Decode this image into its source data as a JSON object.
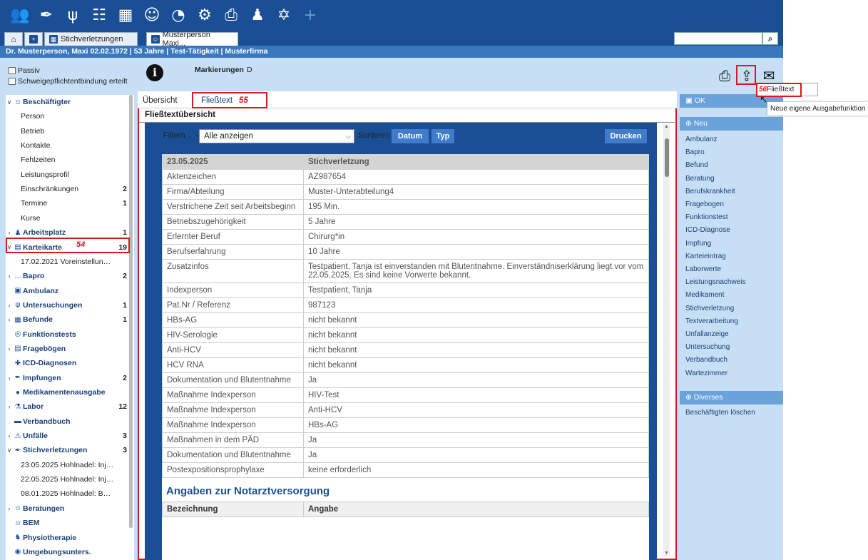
{
  "toolbar": {
    "icons": [
      "group-icon",
      "syringe-icon",
      "stethoscope-icon",
      "org-chart-icon",
      "calendar-icon",
      "person-tie-icon",
      "pie-chart-icon",
      "gear-icon",
      "printer-icon",
      "worker-icon",
      "needle-alert-icon",
      "plus-icon"
    ]
  },
  "tabs": [
    {
      "label": ""
    },
    {
      "label": ""
    },
    {
      "label": "Stichverletzungen"
    },
    {
      "label": "Musterperson Maxi..."
    }
  ],
  "search": {
    "placeholder": ""
  },
  "person_bar": "Dr. Musterperson, Maxi 02.02.1972 | 53 Jahre | Test-Tätigkeit | Musterfirma",
  "header": {
    "passiv": "Passiv",
    "schweige": "Schweigepflichtentbindung erteilt",
    "mark_label": "Markierungen",
    "mark_value": "D"
  },
  "annotations": {
    "a54": "54",
    "a55": "55",
    "a56": "56"
  },
  "sidebar": [
    {
      "label": "Beschäftigter",
      "bold": true,
      "arrow": "v",
      "icon": "person",
      "count": ""
    },
    {
      "label": "Person",
      "sub": true,
      "count": ""
    },
    {
      "label": "Betrieb",
      "sub": true,
      "count": ""
    },
    {
      "label": "Kontakte",
      "sub": true,
      "count": ""
    },
    {
      "label": "Fehlzeiten",
      "sub": true,
      "count": ""
    },
    {
      "label": "Leistungsprofil",
      "sub": true,
      "count": ""
    },
    {
      "label": "Einschränkungen",
      "sub": true,
      "count": "2"
    },
    {
      "label": "Termine",
      "sub": true,
      "count": "1"
    },
    {
      "label": "Kurse",
      "sub": true,
      "count": ""
    },
    {
      "label": "Arbeitsplatz",
      "bold": true,
      "arrow": ">",
      "icon": "worker",
      "count": "1"
    },
    {
      "label": "Karteikarte",
      "bold": true,
      "arrow": "v",
      "icon": "card",
      "count": "19"
    },
    {
      "label": "17.02.2021 Voreinstellunge...",
      "sub": true,
      "count": ""
    },
    {
      "label": "Bapro",
      "bold": true,
      "arrow": ">",
      "icon": "dots",
      "count": "2"
    },
    {
      "label": "Ambulanz",
      "bold": true,
      "arrow": "",
      "icon": "ambulance",
      "count": ""
    },
    {
      "label": "Untersuchungen",
      "bold": true,
      "arrow": ">",
      "icon": "stetho",
      "count": "1"
    },
    {
      "label": "Befunde",
      "bold": true,
      "arrow": ">",
      "icon": "findings",
      "count": "1"
    },
    {
      "label": "Funktionstests",
      "bold": true,
      "arrow": "",
      "icon": "test",
      "count": ""
    },
    {
      "label": "Fragebögen",
      "bold": true,
      "arrow": ">",
      "icon": "form",
      "count": ""
    },
    {
      "label": "ICD-Diagnosen",
      "bold": true,
      "arrow": "",
      "icon": "icd",
      "count": ""
    },
    {
      "label": "Impfungen",
      "bold": true,
      "arrow": ">",
      "icon": "syringe",
      "count": "2"
    },
    {
      "label": "Medikamentenausgabe",
      "bold": true,
      "arrow": "",
      "icon": "pills",
      "count": ""
    },
    {
      "label": "Labor",
      "bold": true,
      "arrow": ">",
      "icon": "lab",
      "count": "12"
    },
    {
      "label": "Verbandbuch",
      "bold": true,
      "arrow": "",
      "icon": "book",
      "count": ""
    },
    {
      "label": "Unfälle",
      "bold": true,
      "arrow": ">",
      "icon": "accident",
      "count": "3"
    },
    {
      "label": "Stichverletzungen",
      "bold": true,
      "arrow": "v",
      "icon": "needle",
      "count": "3"
    },
    {
      "label": "23.05.2025 Hohlnadel: Injek...",
      "sub": true,
      "count": ""
    },
    {
      "label": "22.05.2025 Hohlnadel: Injek...",
      "sub": true,
      "count": ""
    },
    {
      "label": "08.01.2025 Hohlnadel: Butt...",
      "sub": true,
      "count": ""
    },
    {
      "label": "Beratungen",
      "bold": true,
      "arrow": ">",
      "icon": "consult",
      "count": ""
    },
    {
      "label": "BEM",
      "bold": true,
      "arrow": "",
      "icon": "bem",
      "count": ""
    },
    {
      "label": "Physiotherapie",
      "bold": true,
      "arrow": "",
      "icon": "physio",
      "count": ""
    },
    {
      "label": "Umgebungsunters.",
      "bold": true,
      "arrow": "",
      "icon": "env",
      "count": ""
    }
  ],
  "subtabs": {
    "overview": "Übersicht",
    "fliesstext": "Fließtext"
  },
  "ft_title": "Fließtextübersicht",
  "filter": {
    "label": "Filtern ..",
    "value": "Alle anzeigen",
    "sort_label": "Sortieren ..",
    "btn_date": "Datum",
    "btn_type": "Typ",
    "btn_print": "Drucken"
  },
  "table": {
    "header": [
      "23.05.2025",
      "Stichverletzung"
    ],
    "rows": [
      [
        "Aktenzeichen",
        "AZ987654"
      ],
      [
        "Firma/Abteilung",
        "Muster-Unterabteilung4"
      ],
      [
        "Verstrichene Zeit seit Arbeitsbeginn",
        "195 Min."
      ],
      [
        "Betriebszugehörigkeit",
        "5 Jahre"
      ],
      [
        "Erlernter Beruf",
        "Chirurg*in"
      ],
      [
        "Berufserfahrung",
        "10 Jahre"
      ],
      [
        "Zusatzinfos",
        "Testpatient, Tanja ist einverstanden mit Blutentnahme. Einverständniserklärung liegt vor vom 22.05.2025. Es sind keine Vorwerte bekannt."
      ],
      [
        "Indexperson",
        "Testpatient, Tanja"
      ],
      [
        "Pat.Nr / Referenz",
        "987123"
      ],
      [
        "HBs-AG",
        "nicht bekannt"
      ],
      [
        "HIV-Serologie",
        "nicht bekannt"
      ],
      [
        "Anti-HCV",
        "nicht bekannt"
      ],
      [
        "HCV RNA",
        "nicht bekannt"
      ],
      [
        "Dokumentation und Blutentnahme",
        "Ja"
      ],
      [
        "Maßnahme Indexperson",
        "HIV-Test"
      ],
      [
        "Maßnahme Indexperson",
        "Anti-HCV"
      ],
      [
        "Maßnahme Indexperson",
        "HBs-AG"
      ],
      [
        "Maßnahmen in dem PÄD",
        "Ja"
      ],
      [
        "Dokumentation und Blutentnahme",
        "Ja"
      ],
      [
        "Postexpositionsprophylaxe",
        "keine erforderlich"
      ]
    ],
    "section_title": "Angaben zur Notarztversorgung",
    "col_headers": [
      "Bezeichnung",
      "Angabe"
    ]
  },
  "rpanel": {
    "ok": "OK",
    "neu": "Neu",
    "items": [
      "Ambulanz",
      "Bapro",
      "Befund",
      "Beratung",
      "Berufskrankheit",
      "Fragebogen",
      "Funktionstest",
      "ICD-Diagnose",
      "Impfung",
      "Karteieintrag",
      "Laborwerte",
      "Leistungsnachweis",
      "Medikament",
      "Stichverletzung",
      "Textverarbeitung",
      "Unfallanzeige",
      "Untersuchung",
      "Verbandbuch",
      "Wartezimmer"
    ],
    "diverses": "Diverses",
    "delete": "Beschäftigten löschen"
  },
  "tooltip": {
    "fliesstext": "Fließtext",
    "custom": "Neue eigene Ausgabefunktion"
  }
}
